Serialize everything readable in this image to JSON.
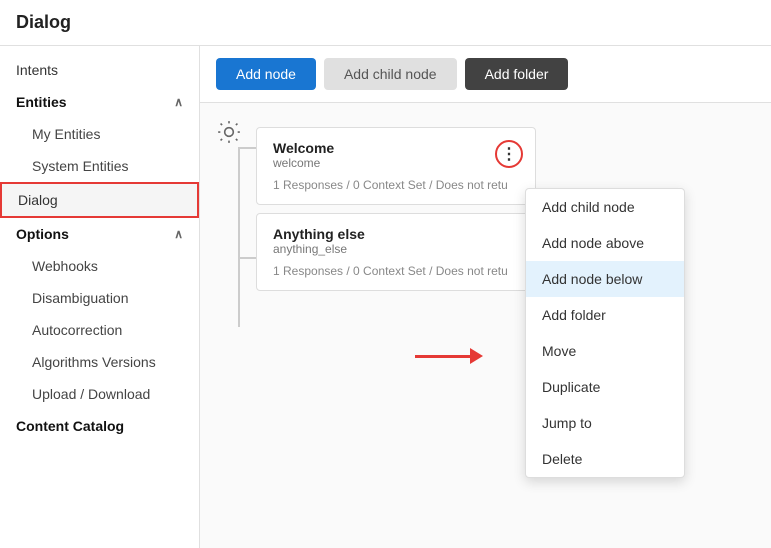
{
  "app": {
    "title": "Dialog"
  },
  "toolbar": {
    "add_node_label": "Add node",
    "add_child_node_label": "Add child node",
    "add_folder_label": "Add folder"
  },
  "sidebar": {
    "intents_label": "Intents",
    "entities_label": "Entities",
    "entities_chevron": "∧",
    "my_entities_label": "My Entities",
    "system_entities_label": "System Entities",
    "dialog_label": "Dialog",
    "options_label": "Options",
    "options_chevron": "∧",
    "webhooks_label": "Webhooks",
    "disambiguation_label": "Disambiguation",
    "autocorrection_label": "Autocorrection",
    "algorithms_label": "Algorithms Versions",
    "upload_download_label": "Upload / Download",
    "content_catalog_label": "Content Catalog"
  },
  "nodes": [
    {
      "id": "node-welcome",
      "title": "Welcome",
      "node_id": "welcome",
      "meta": "1 Responses / 0 Context Set / Does not retu"
    },
    {
      "id": "node-anything-else",
      "title": "Anything else",
      "node_id": "anything_else",
      "meta": "1 Responses / 0 Context Set / Does not retu"
    }
  ],
  "dropdown": {
    "items": [
      {
        "label": "Add child node",
        "highlighted": false
      },
      {
        "label": "Add node above",
        "highlighted": false
      },
      {
        "label": "Add node below",
        "highlighted": true
      },
      {
        "label": "Add folder",
        "highlighted": false
      },
      {
        "label": "Move",
        "highlighted": false
      },
      {
        "label": "Duplicate",
        "highlighted": false
      },
      {
        "label": "Jump to",
        "highlighted": false
      },
      {
        "label": "Delete",
        "highlighted": false
      }
    ]
  },
  "icons": {
    "more_dots": "⋮",
    "sun_icon": "⚙",
    "chevron_up": "∧"
  },
  "colors": {
    "primary_blue": "#1976d2",
    "dark_btn": "#424242",
    "red_border": "#e53935",
    "highlight_bg": "#e3f2fd"
  }
}
